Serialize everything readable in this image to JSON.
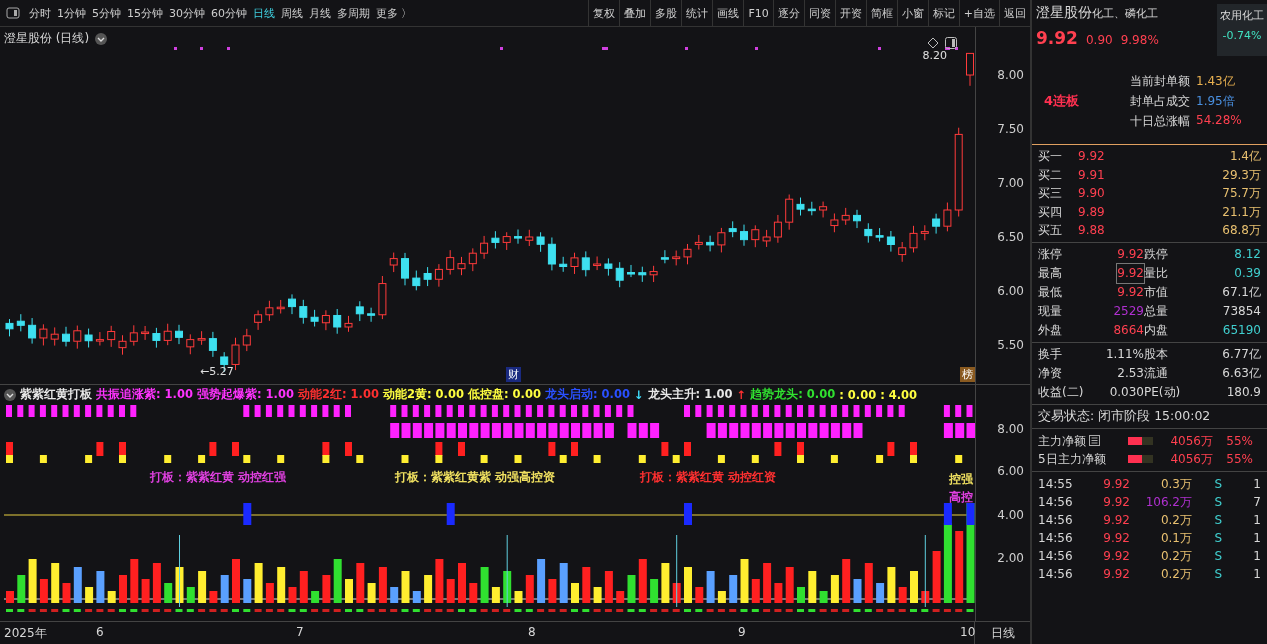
{
  "toolbar": {
    "periods": [
      {
        "label": "分时",
        "selected": false
      },
      {
        "label": "1分钟",
        "selected": false
      },
      {
        "label": "5分钟",
        "selected": false
      },
      {
        "label": "15分钟",
        "selected": false
      },
      {
        "label": "30分钟",
        "selected": false
      },
      {
        "label": "60分钟",
        "selected": false
      },
      {
        "label": "日线",
        "selected": true
      },
      {
        "label": "周线",
        "selected": false
      },
      {
        "label": "月线",
        "selected": false
      },
      {
        "label": "多周期",
        "selected": false
      },
      {
        "label": "更多 〉",
        "selected": false
      }
    ],
    "buttons": [
      "复权",
      "叠加",
      "多股",
      "统计",
      "画线",
      "F10",
      "逐分",
      "同资",
      "开资",
      "简框",
      "小窗",
      "标记",
      "+自选",
      "返回"
    ]
  },
  "chart": {
    "title": "澄星股份 (日线)",
    "high_label": "8.20",
    "low_label": "←5.27",
    "badges": [
      {
        "text": "财",
        "kind": "news"
      },
      {
        "text": "榜",
        "kind": "rank"
      }
    ],
    "price_ticks": [
      "8.00",
      "7.50",
      "7.00",
      "6.50",
      "6.00",
      "5.50"
    ]
  },
  "indicator": {
    "legend": [
      {
        "text": "紫紫红黄打板",
        "color": "#e8e8e8"
      },
      {
        "text": "共振追涨紫: 1.00",
        "color": "#ff33ff"
      },
      {
        "text": "强势起爆紫: 1.00",
        "color": "#ff33ff"
      },
      {
        "text": "动能2红: 1.00",
        "color": "#ff3030"
      },
      {
        "text": "动能2黄: 0.00",
        "color": "#ffff40"
      },
      {
        "text": "低控盘: 0.00",
        "color": "#ffff40"
      },
      {
        "text": "龙头启动: 0.00",
        "color": "#2a50ff"
      },
      {
        "text": "↓",
        "color": "#40e0ff"
      },
      {
        "text": "龙头主升: 1.00",
        "color": "#e8e8e8"
      },
      {
        "text": "↑",
        "color": "#ff3030"
      },
      {
        "text": "趋势龙头: 0.00",
        "color": "#30e030"
      },
      {
        "text": ": 0.00 : 4.00",
        "color": "#ffff40"
      }
    ],
    "notes": [
      {
        "text": "打板：紫紫红黄  动控红强",
        "color": "#e040e0"
      },
      {
        "text": "打板：紫紫红黄紫  动强高控资",
        "color": "#f0e060"
      },
      {
        "text": "打板：紫紫红黄  动控红资",
        "color": "#ff3030"
      }
    ],
    "end_labels": [
      {
        "text": "控强",
        "color": "#f0e060"
      },
      {
        "text": "高控",
        "color": "#e040e0"
      }
    ],
    "ticks": [
      "8.00",
      "6.00",
      "4.00",
      "2.00"
    ]
  },
  "x_axis": {
    "labels": [
      "2025年",
      "6",
      "7",
      "8",
      "9",
      "10"
    ],
    "period": "日线"
  },
  "quote": {
    "name": "澄星股份",
    "sectors": "化工、磷化工",
    "industry": "农用化工",
    "industry_change": "-0.74%",
    "price": "9.92",
    "change": "0.90",
    "change_pct": "9.98%",
    "streak": "4连板",
    "seal_stats": [
      {
        "label": "当前封单额",
        "value": "1.43亿",
        "color": "#e8b050"
      },
      {
        "label": "封单占成交",
        "value": "1.95倍",
        "color": "#4a90e0"
      },
      {
        "label": "十日总涨幅",
        "value": "54.28%",
        "color": "#ff4050"
      }
    ],
    "order_book": [
      {
        "label": "买一",
        "price": "9.92",
        "volume": "1.4亿"
      },
      {
        "label": "买二",
        "price": "9.91",
        "volume": "29.3万"
      },
      {
        "label": "买三",
        "price": "9.90",
        "volume": "75.7万"
      },
      {
        "label": "买四",
        "price": "9.89",
        "volume": "21.1万"
      },
      {
        "label": "买五",
        "price": "9.88",
        "volume": "68.8万"
      }
    ],
    "stats": [
      {
        "label": "涨停",
        "value": "9.92",
        "color": "#ff4050",
        "highlighted": false
      },
      {
        "label": "跌停",
        "value": "8.12",
        "color": "#40d0d0",
        "highlighted": false
      },
      {
        "label": "最高",
        "value": "9.92",
        "color": "#ff4050",
        "highlighted": true
      },
      {
        "label": "量比",
        "value": "0.39",
        "color": "#40d0d0",
        "highlighted": false
      },
      {
        "label": "最低",
        "value": "9.92",
        "color": "#ff4050",
        "highlighted": false
      },
      {
        "label": "市值",
        "value": "67.1亿",
        "color": "#d8d8d8",
        "highlighted": false
      },
      {
        "label": "现量",
        "value": "2529",
        "color": "#b030d0",
        "highlighted": false
      },
      {
        "label": "总量",
        "value": "73854",
        "color": "#d8d8d8",
        "highlighted": false
      },
      {
        "label": "外盘",
        "value": "8664",
        "color": "#ff4050",
        "highlighted": false
      },
      {
        "label": "内盘",
        "value": "65190",
        "color": "#40d0d0",
        "highlighted": false
      }
    ],
    "fundamentals": [
      {
        "label": "换手",
        "value": "1.11%"
      },
      {
        "label": "股本",
        "value": "6.77亿"
      },
      {
        "label": "净资",
        "value": "2.53"
      },
      {
        "label": "流通",
        "value": "6.63亿"
      },
      {
        "label": "收益(二)",
        "value": "0.030"
      },
      {
        "label": "PE(动)",
        "value": "180.9"
      }
    ],
    "status": "交易状态: 闭市阶段 15:00:02",
    "fund_flow": [
      {
        "label": "主力净额",
        "amount": "4056万",
        "pct": "55%",
        "level": 0.55
      },
      {
        "label": "5日主力净额",
        "amount": "4056万",
        "pct": "55%",
        "level": 0.55
      }
    ],
    "trades": [
      {
        "time": "14:55",
        "price": "9.92",
        "volume": "0.3万",
        "color": "#e8c070",
        "side": "S",
        "count": "1"
      },
      {
        "time": "14:56",
        "price": "9.92",
        "volume": "106.2万",
        "color": "#b030d0",
        "side": "S",
        "count": "7"
      },
      {
        "time": "14:56",
        "price": "9.92",
        "volume": "0.2万",
        "color": "#e8c070",
        "side": "S",
        "count": "1"
      },
      {
        "time": "14:56",
        "price": "9.92",
        "volume": "0.1万",
        "color": "#e8c070",
        "side": "S",
        "count": "1"
      },
      {
        "time": "14:56",
        "price": "9.92",
        "volume": "0.2万",
        "color": "#e8c070",
        "side": "S",
        "count": "1"
      },
      {
        "time": "14:56",
        "price": "9.92",
        "volume": "0.2万",
        "color": "#e8c070",
        "side": "S",
        "count": "1"
      }
    ]
  }
}
